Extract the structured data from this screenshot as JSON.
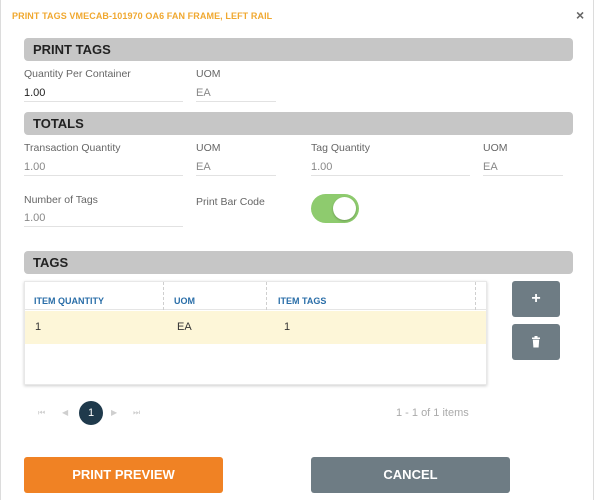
{
  "dialog": {
    "title": "PRINT TAGS VMECAB-101970 OA6 FAN FRAME, LEFT RAIL",
    "close_glyph": "×"
  },
  "print_tags": {
    "header": "PRINT TAGS",
    "quantity_per_container": {
      "label": "Quantity Per Container",
      "value": "1.00"
    },
    "uom": {
      "label": "UOM",
      "value": "EA"
    }
  },
  "totals": {
    "header": "TOTALS",
    "transaction_quantity": {
      "label": "Transaction Quantity",
      "value": "1.00"
    },
    "uom1": {
      "label": "UOM",
      "value": "EA"
    },
    "tag_quantity": {
      "label": "Tag Quantity",
      "value": "1.00"
    },
    "uom2": {
      "label": "UOM",
      "value": "EA"
    },
    "number_of_tags": {
      "label": "Number of Tags",
      "value": "1.00"
    },
    "print_bar_code": {
      "label": "Print Bar Code",
      "enabled": true
    }
  },
  "tags": {
    "header": "TAGS",
    "columns": [
      "ITEM QUANTITY",
      "UOM",
      "ITEM TAGS"
    ],
    "rows": [
      [
        "1",
        "EA",
        "1"
      ]
    ],
    "add_glyph": "+",
    "delete_icon": "trash-icon"
  },
  "pager": {
    "first": "⏮",
    "prev": "◀",
    "current": "1",
    "next": "▶",
    "last": "⏭",
    "info": "1 - 1 of 1 items"
  },
  "buttons": {
    "print_preview": "PRINT PREVIEW",
    "cancel": "CANCEL"
  },
  "colors": {
    "title": "#f0a830",
    "section_bar": "#c6c6c6",
    "toggle_on": "#8ecb6e",
    "selected_row": "#fdf6d8",
    "primary_button": "#f08224",
    "secondary_button": "#6e7c84",
    "pager_active": "#1f3a4c",
    "column_header": "#2a6ea8"
  }
}
